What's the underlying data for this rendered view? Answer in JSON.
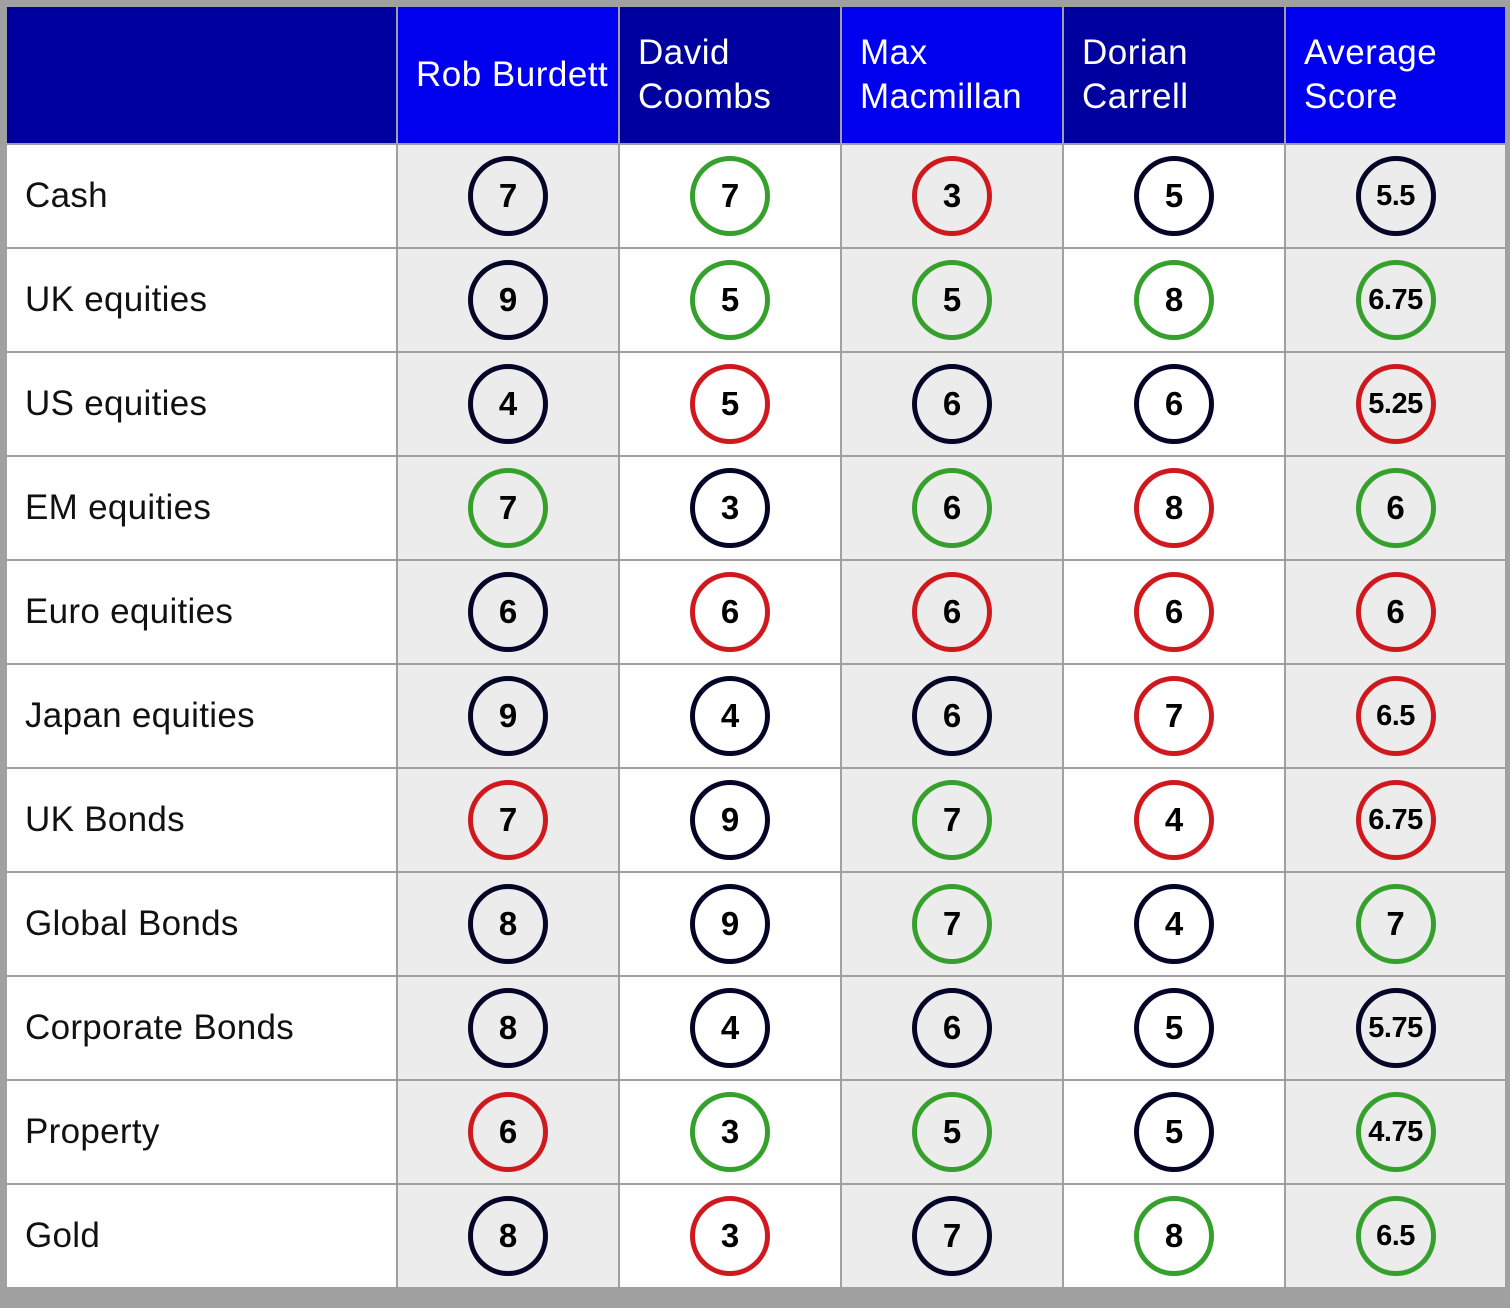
{
  "colors": {
    "header_dark": "#00009e",
    "header_bright": "#0000ee",
    "neutral": "#050528",
    "positive": "#36a02c",
    "negative": "#d0191e"
  },
  "headers": [
    "",
    "Rob Burdett",
    "David Coombs",
    "Max Macmillan",
    "Dorian Carrell",
    "Average Score"
  ],
  "rows": [
    {
      "label": "Cash",
      "scores": [
        {
          "v": "7",
          "c": "navy"
        },
        {
          "v": "7",
          "c": "green"
        },
        {
          "v": "3",
          "c": "red"
        },
        {
          "v": "5",
          "c": "navy"
        },
        {
          "v": "5.5",
          "c": "navy"
        }
      ]
    },
    {
      "label": "UK equities",
      "scores": [
        {
          "v": "9",
          "c": "navy"
        },
        {
          "v": "5",
          "c": "green"
        },
        {
          "v": "5",
          "c": "green"
        },
        {
          "v": "8",
          "c": "green"
        },
        {
          "v": "6.75",
          "c": "green"
        }
      ]
    },
    {
      "label": "US equities",
      "scores": [
        {
          "v": "4",
          "c": "navy"
        },
        {
          "v": "5",
          "c": "red"
        },
        {
          "v": "6",
          "c": "navy"
        },
        {
          "v": "6",
          "c": "navy"
        },
        {
          "v": "5.25",
          "c": "red"
        }
      ]
    },
    {
      "label": "EM equities",
      "scores": [
        {
          "v": "7",
          "c": "green"
        },
        {
          "v": "3",
          "c": "navy"
        },
        {
          "v": "6",
          "c": "green"
        },
        {
          "v": "8",
          "c": "red"
        },
        {
          "v": "6",
          "c": "green"
        }
      ]
    },
    {
      "label": "Euro equities",
      "scores": [
        {
          "v": "6",
          "c": "navy"
        },
        {
          "v": "6",
          "c": "red"
        },
        {
          "v": "6",
          "c": "red"
        },
        {
          "v": "6",
          "c": "red"
        },
        {
          "v": "6",
          "c": "red"
        }
      ]
    },
    {
      "label": "Japan equities",
      "scores": [
        {
          "v": "9",
          "c": "navy"
        },
        {
          "v": "4",
          "c": "navy"
        },
        {
          "v": "6",
          "c": "navy"
        },
        {
          "v": "7",
          "c": "red"
        },
        {
          "v": "6.5",
          "c": "red"
        }
      ]
    },
    {
      "label": "UK Bonds",
      "scores": [
        {
          "v": "7",
          "c": "red"
        },
        {
          "v": "9",
          "c": "navy"
        },
        {
          "v": "7",
          "c": "green"
        },
        {
          "v": "4",
          "c": "red"
        },
        {
          "v": "6.75",
          "c": "red"
        }
      ]
    },
    {
      "label": "Global Bonds",
      "scores": [
        {
          "v": "8",
          "c": "navy"
        },
        {
          "v": "9",
          "c": "navy"
        },
        {
          "v": "7",
          "c": "green"
        },
        {
          "v": "4",
          "c": "navy"
        },
        {
          "v": "7",
          "c": "green"
        }
      ]
    },
    {
      "label": "Corporate Bonds",
      "scores": [
        {
          "v": "8",
          "c": "navy"
        },
        {
          "v": "4",
          "c": "navy"
        },
        {
          "v": "6",
          "c": "navy"
        },
        {
          "v": "5",
          "c": "navy"
        },
        {
          "v": "5.75",
          "c": "navy"
        }
      ]
    },
    {
      "label": "Property",
      "scores": [
        {
          "v": "6",
          "c": "red"
        },
        {
          "v": "3",
          "c": "green"
        },
        {
          "v": "5",
          "c": "green"
        },
        {
          "v": "5",
          "c": "navy"
        },
        {
          "v": "4.75",
          "c": "green"
        }
      ]
    },
    {
      "label": "Gold",
      "scores": [
        {
          "v": "8",
          "c": "navy"
        },
        {
          "v": "3",
          "c": "red"
        },
        {
          "v": "7",
          "c": "navy"
        },
        {
          "v": "8",
          "c": "green"
        },
        {
          "v": "6.5",
          "c": "green"
        }
      ]
    }
  ]
}
